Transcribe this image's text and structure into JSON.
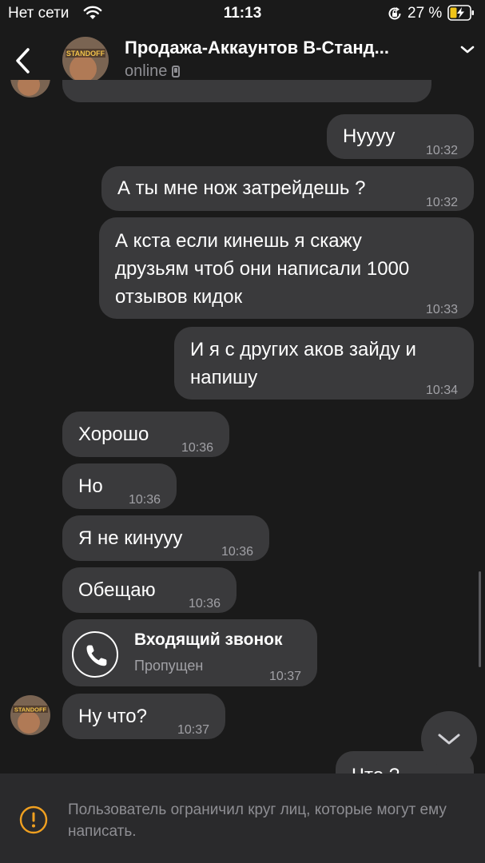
{
  "status_bar": {
    "carrier": "Нет сети",
    "time": "11:13",
    "battery": "27 %"
  },
  "header": {
    "title": "Продажа-Аккаунтов В-Станд...",
    "subtitle": "online",
    "avatar_text": "STANDOFF"
  },
  "messages": [
    {
      "text": "Нуууу",
      "time": "10:32",
      "direction": "outgoing"
    },
    {
      "text": "А ты мне нож затрейдешь ?",
      "time": "10:32",
      "direction": "outgoing"
    },
    {
      "text": [
        "А кста если кинешь я скажу",
        "друзьям чтоб они написали 1000",
        "отзывов кидок"
      ],
      "time": "10:33",
      "direction": "outgoing"
    },
    {
      "text": [
        "И я с других аков зайду и",
        "напишу"
      ],
      "time": "10:34",
      "direction": "outgoing"
    },
    {
      "text": "Хорошо",
      "time": "10:36",
      "direction": "incoming"
    },
    {
      "text": "Но",
      "time": "10:36",
      "direction": "incoming"
    },
    {
      "text": "Я не кинууу",
      "time": "10:36",
      "direction": "incoming"
    },
    {
      "text": "Обещаю",
      "time": "10:36",
      "direction": "incoming"
    },
    {
      "call_title": "Входящий звонок",
      "call_status": "Пропущен",
      "time": "10:37",
      "direction": "incoming",
      "icon": "phone-icon"
    },
    {
      "text": "Ну что?",
      "time": "10:37",
      "direction": "incoming"
    },
    {
      "text": "Что ?",
      "time": "",
      "direction": "outgoing"
    }
  ],
  "footer": {
    "notice": "Пользователь ограничил круг лиц, которые могут ему написать."
  },
  "colors": {
    "background": "#1a1a1a",
    "bubble": "#3a3a3c",
    "footer": "#2a2a2c",
    "muted": "#8e8e93",
    "battery_accent": "#f0c419"
  }
}
